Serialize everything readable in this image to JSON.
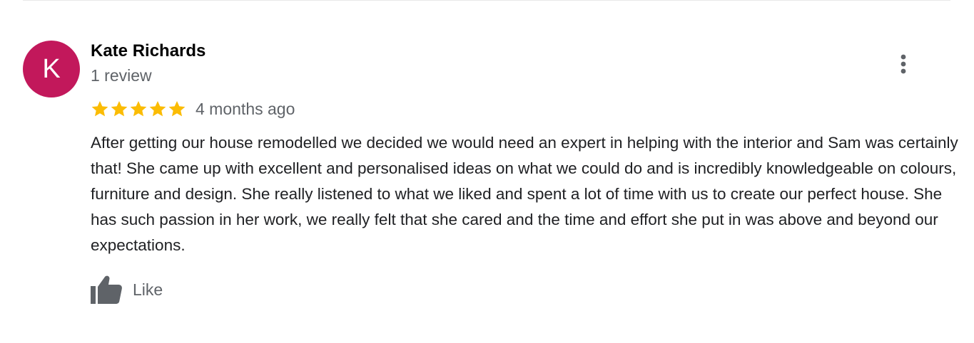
{
  "review": {
    "avatar_letter": "K",
    "avatar_color": "#c2185b",
    "reviewer_name": "Kate Richards",
    "review_count": "1 review",
    "rating": 5,
    "rating_max": 5,
    "star_color": "#fbbc04",
    "date": "4 months ago",
    "text": "After getting our house remodelled we decided we would need an expert in helping with the interior and Sam was certainly that! She came up with excellent and personalised ideas on what we could do and is incredibly knowledgeable on colours, furniture and design. She really listened to what we liked and spent a lot of time with us to create our perfect house. She has such passion in her work, we really felt that she cared and the time and effort she put in was above and beyond our expectations.",
    "like_label": "Like",
    "more_icon": "more-vert-icon",
    "like_icon": "thumbs-up-icon"
  }
}
